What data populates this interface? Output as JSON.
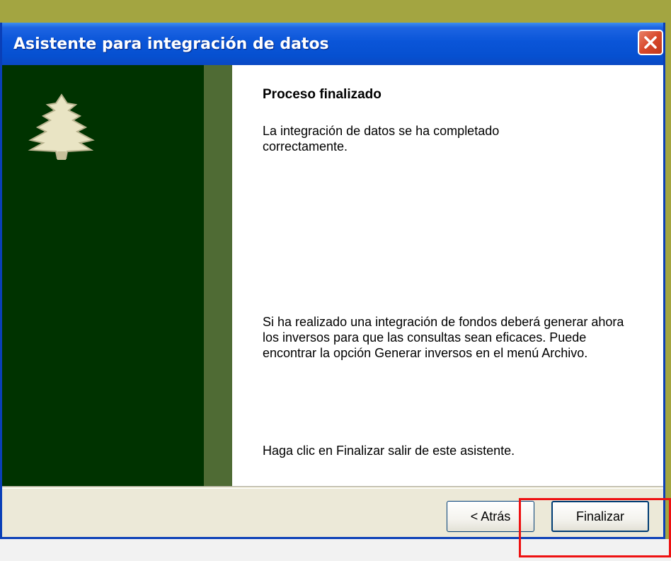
{
  "window": {
    "title": "Asistente para integración de datos"
  },
  "content": {
    "heading": "Proceso finalizado",
    "paragraph1": "La integración de datos se ha completado correctamente.",
    "paragraph2": "Si ha realizado una integración de fondos deberá generar ahora los inversos para que las consultas sean eficaces. Puede encontrar la opción Generar inversos en el menú Archivo.",
    "paragraph3": "Haga clic en Finalizar salir de este asistente."
  },
  "buttons": {
    "back_label": "< Atrás",
    "finish_label": "Finalizar"
  },
  "icons": {
    "sidebar": "tree-icon",
    "close": "close-icon"
  },
  "colors": {
    "sidebar": "#003300",
    "sidebar_stripe": "#4f6b34",
    "title_bar": "#0a55d8",
    "highlight": "#ee1111"
  }
}
